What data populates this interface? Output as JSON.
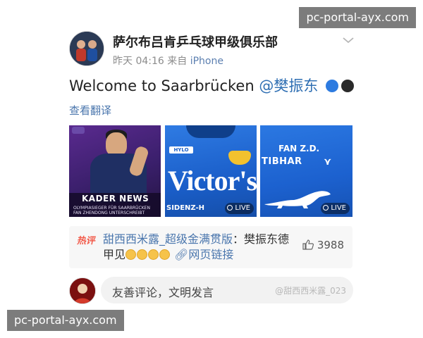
{
  "post": {
    "author": "萨尔布吕肯乒乓球甲级俱乐部",
    "time": "昨天 04:16",
    "source_prefix": "来自",
    "device": "iPhone",
    "text": "Welcome to Saarbrücken ",
    "mention": "@樊振东",
    "translate_label": "查看翻译"
  },
  "images": [
    {
      "title": "KADER NEWS",
      "subtitle_lines": [
        "OLYMPIASIEGER FÜR SAARBRÜCKEN",
        "FAN ZHENDONG UNTERSCHREIBT"
      ]
    },
    {
      "sponsor": "HYLO",
      "big_text": "Victor's",
      "bottom_text": "SIDENZ-H",
      "live_label": "LIVE"
    },
    {
      "name_text": "FAN Z.D.",
      "brand_text": "TIBHAR",
      "live_label": "LIVE"
    }
  ],
  "trending": {
    "hot_label": "热评",
    "topic": "甜西西米露_超级金满贯版",
    "text_after": "：樊振东德甲见",
    "link_label": "网页链接",
    "like_count": "3988"
  },
  "comment": {
    "placeholder": "友善评论，文明发言",
    "watermark": "@甜西西米露_023"
  },
  "overlays": {
    "top": "pc-portal-ayx.com",
    "bottom": "pc-portal-ayx.com"
  },
  "colors": {
    "link": "#4a76ad",
    "mention": "#2f6fb3",
    "hot": "#f25a4a",
    "jersey_blue": "#1a5ec9"
  }
}
